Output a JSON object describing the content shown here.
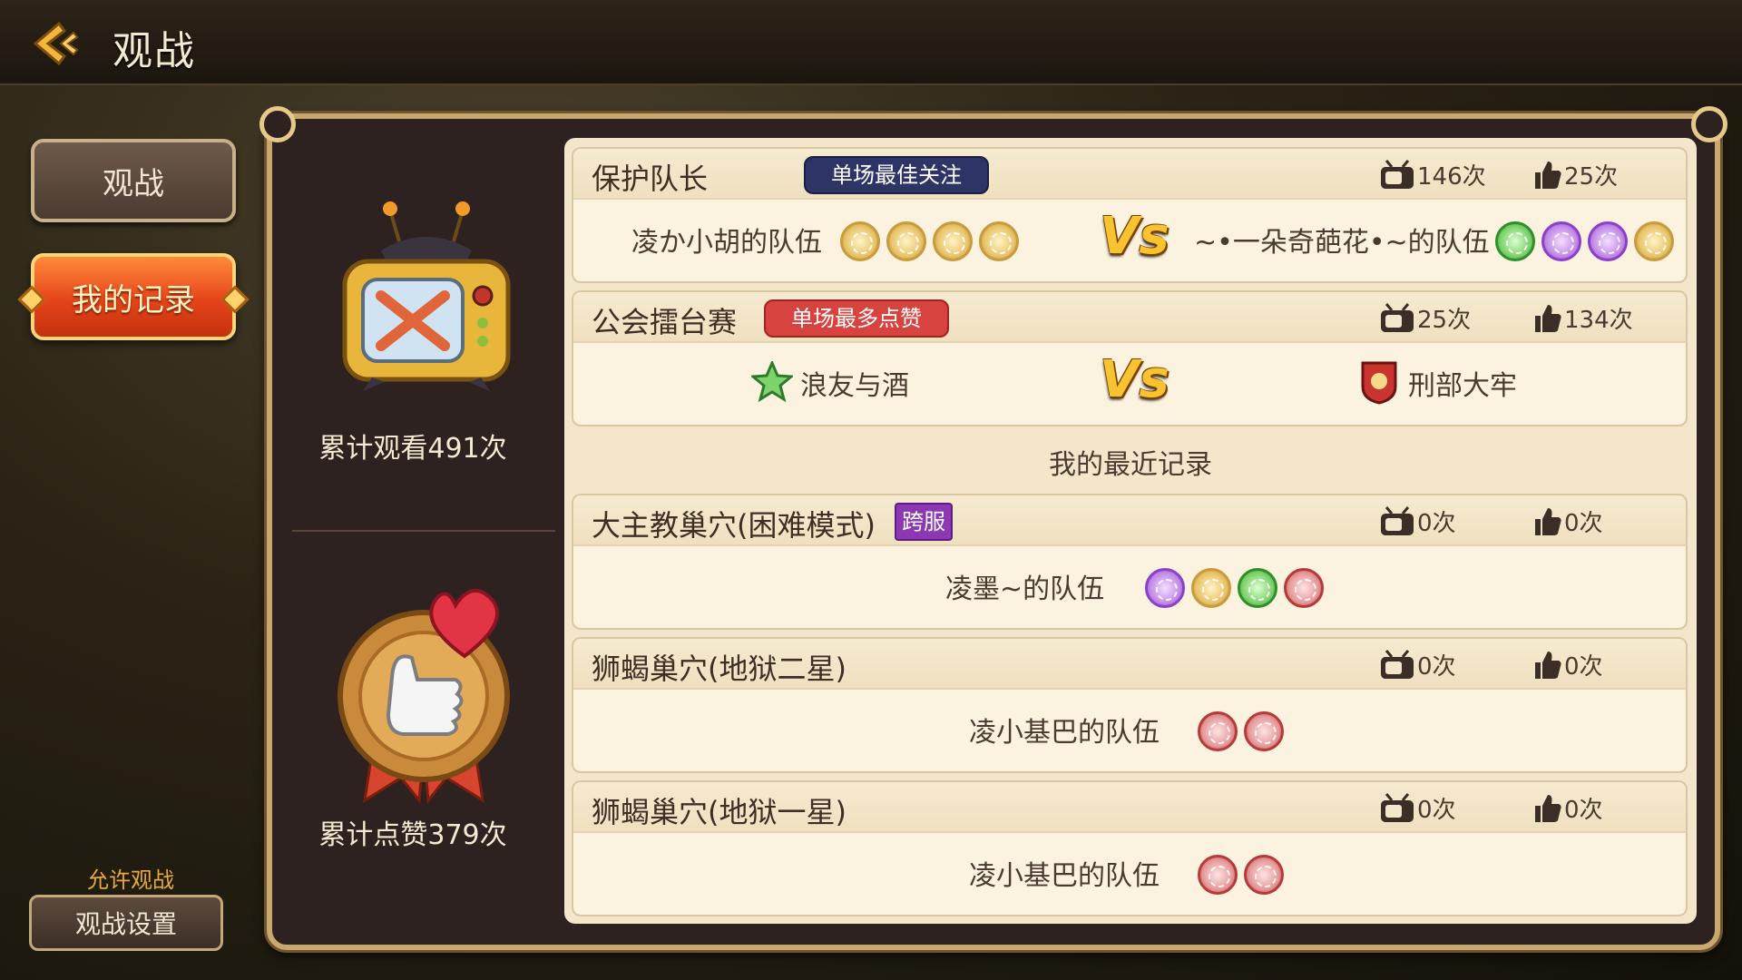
{
  "header": {
    "title": "观战"
  },
  "sidebar": {
    "spectate_label": "观战",
    "records_label": "我的记录",
    "allow_label": "允许观战",
    "settings_label": "观战设置"
  },
  "stats": {
    "views_label": "累计观看491次",
    "likes_label": "累计点赞379次"
  },
  "matches": [
    {
      "title": "保护队长",
      "tag": "单场最佳关注",
      "views": "146次",
      "likes": "25次",
      "left_team": "凌か小胡的队伍",
      "right_team": "~•一朵奇葩花•~的队伍",
      "vs": "Vs"
    },
    {
      "title": "公会擂台赛",
      "tag": "单场最多点赞",
      "views": "25次",
      "likes": "134次",
      "left_team": "浪友与酒",
      "right_team": "刑部大牢",
      "vs": "Vs"
    }
  ],
  "recent_label": "我的最近记录",
  "records": [
    {
      "title": "大主教巢穴(困难模式)",
      "tag": "跨服",
      "views": "0次",
      "likes": "0次",
      "team": "凌墨~的队伍"
    },
    {
      "title": "狮蝎巢穴(地狱二星)",
      "views": "0次",
      "likes": "0次",
      "team": "凌小基巴的队伍"
    },
    {
      "title": "狮蝎巢穴(地狱一星)",
      "views": "0次",
      "likes": "0次",
      "team": "凌小基巴的队伍"
    }
  ],
  "icons": [
    "back-arrow-icon",
    "tv-icon",
    "thumbs-up-icon",
    "trophy-tv-icon",
    "like-medal-icon",
    "guild-emblem-icon",
    "hero-portrait-icon"
  ]
}
